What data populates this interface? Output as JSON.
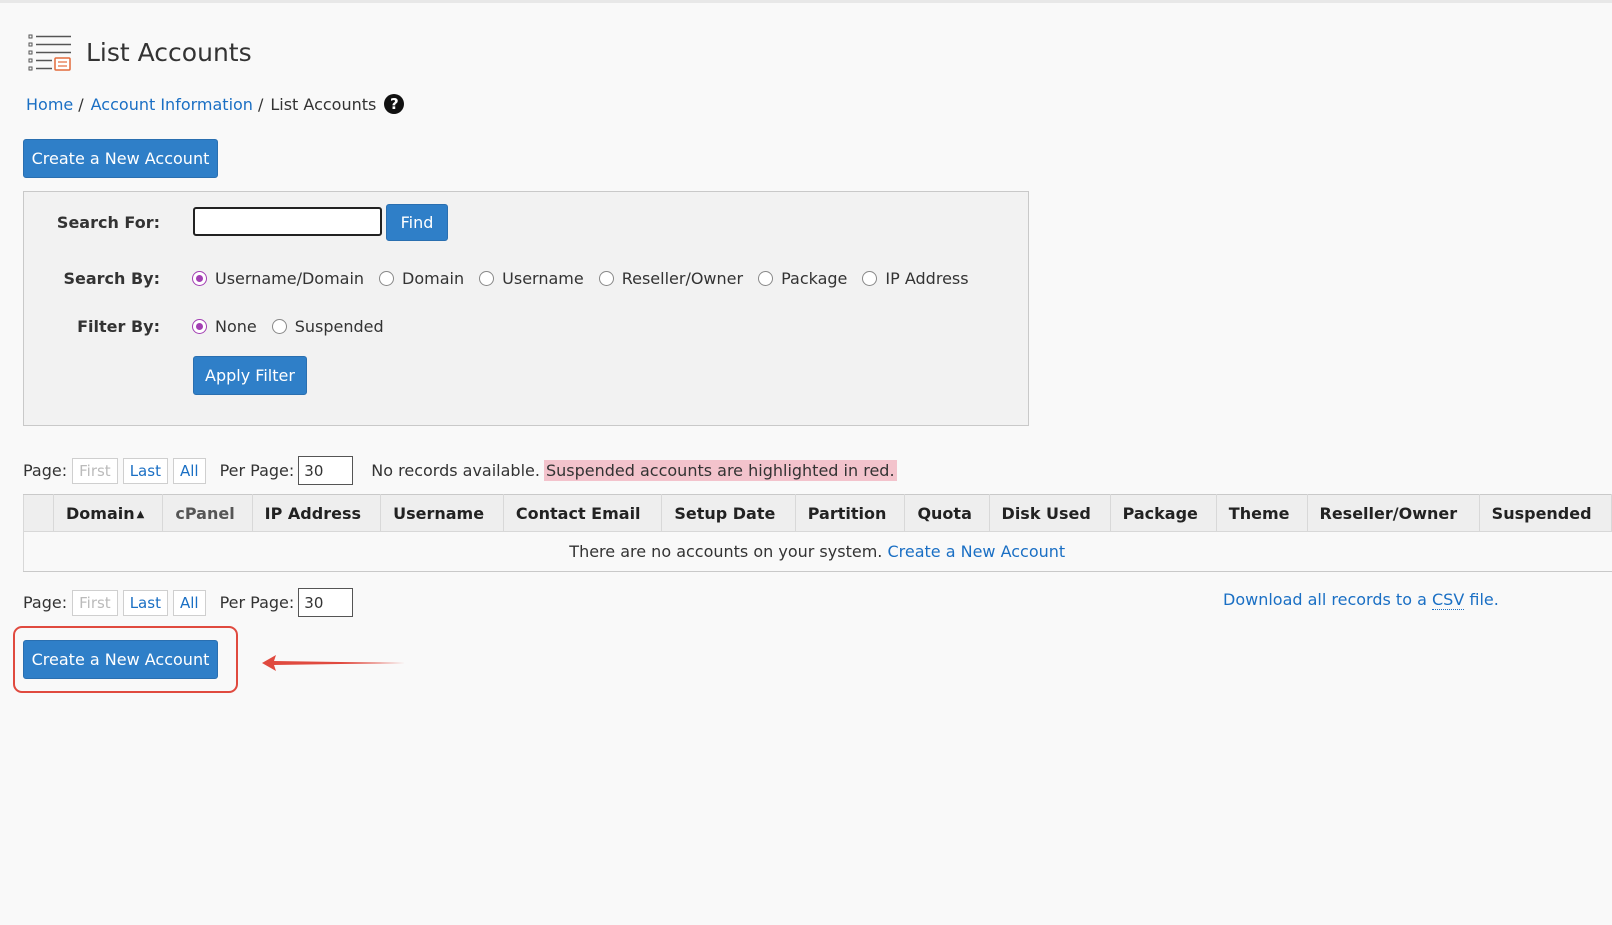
{
  "header": {
    "title": "List Accounts"
  },
  "breadcrumb": {
    "home": "Home",
    "account_info": "Account Information",
    "current": "List Accounts",
    "sep": "/",
    "help": "?"
  },
  "buttons": {
    "create_top": "Create a New Account",
    "find": "Find",
    "apply_filter": "Apply Filter",
    "create_bottom": "Create a New Account"
  },
  "search": {
    "search_for_label": "Search For:",
    "search_value": "",
    "search_by_label": "Search By:",
    "search_by_options": [
      "Username/Domain",
      "Domain",
      "Username",
      "Reseller/Owner",
      "Package",
      "IP Address"
    ],
    "search_by_selected": "Username/Domain",
    "filter_by_label": "Filter By:",
    "filter_options": [
      "None",
      "Suspended"
    ],
    "filter_selected": "None"
  },
  "pager": {
    "page_label": "Page:",
    "first": "First",
    "last": "Last",
    "all": "All",
    "per_page_label": "Per Page:",
    "per_page_value": "30"
  },
  "notice": {
    "no_records": "No records available.",
    "suspended_note": "Suspended accounts are highlighted in red."
  },
  "table": {
    "columns": [
      "Domain",
      "cPanel",
      "IP Address",
      "Username",
      "Contact Email",
      "Setup Date",
      "Partition",
      "Quota",
      "Disk Used",
      "Package",
      "Theme",
      "Reseller/Owner",
      "Suspended"
    ],
    "sort_indicator": "▲",
    "empty_text": "There are no accounts on your system.",
    "empty_link": "Create a New Account"
  },
  "download": {
    "prefix": "Download all records to a",
    "csv": "CSV",
    "suffix": "file."
  },
  "colors": {
    "primary": "#2f7fc8",
    "link": "#1a6fc4",
    "radio": "#a33fb3",
    "highlight": "#f3c3cc",
    "annotation": "#e04a3f"
  }
}
